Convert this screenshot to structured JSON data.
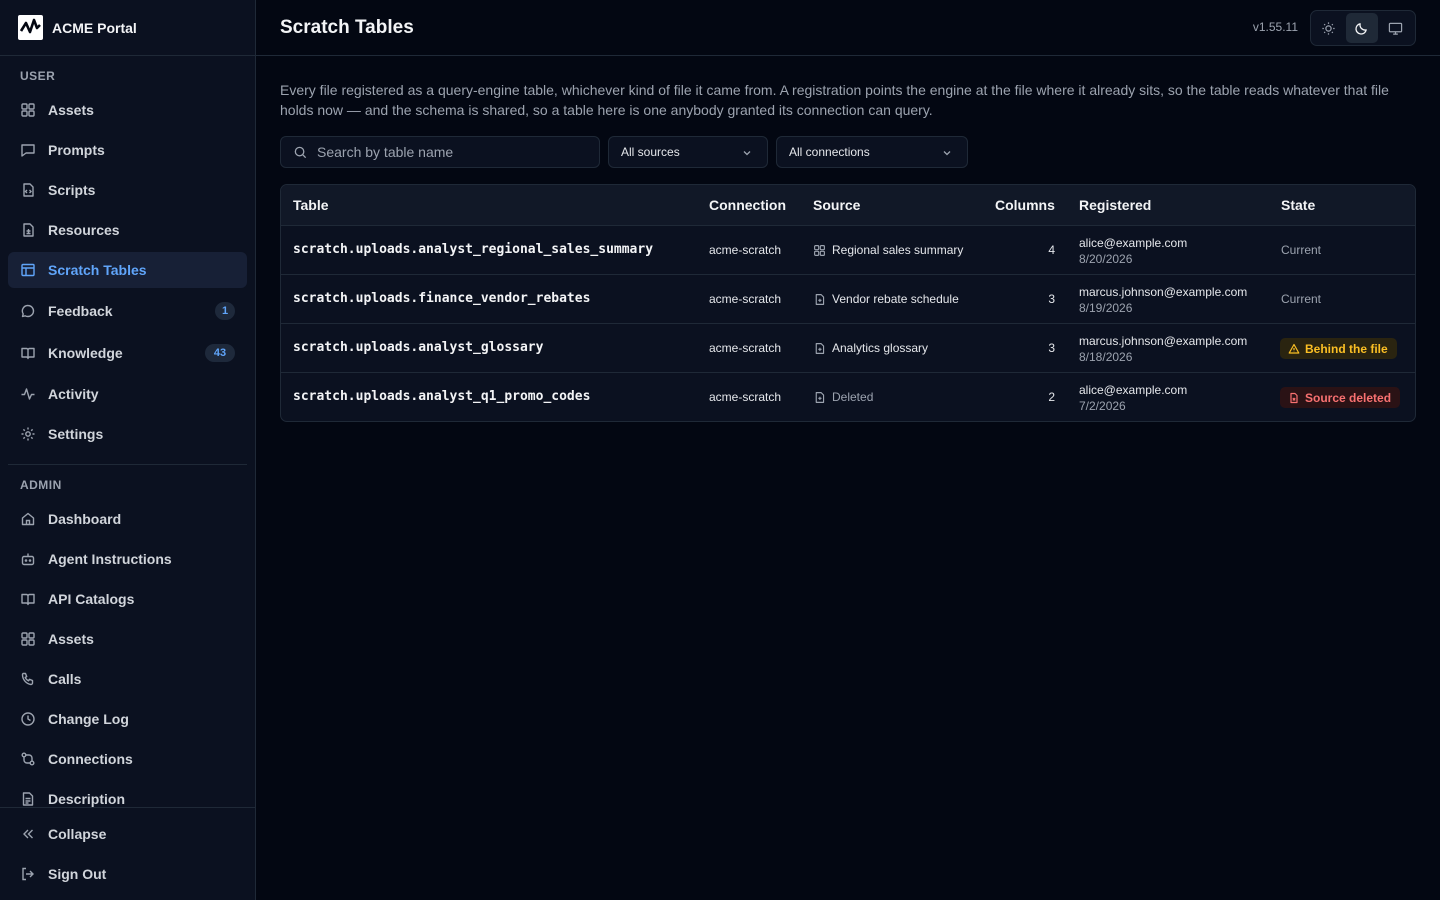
{
  "app": {
    "name": "ACME Portal",
    "version": "v1.55.11"
  },
  "page": {
    "title": "Scratch Tables",
    "description": "Every file registered as a query-engine table, whichever kind of file it came from. A registration points the engine at the file where it already sits, so the table reads whatever that file holds now — and the schema is shared, so a table here is one anybody granted its connection can query."
  },
  "sidebar": {
    "user_label": "USER",
    "admin_label": "ADMIN",
    "user_items": [
      {
        "label": "Assets",
        "icon": "grid-icon"
      },
      {
        "label": "Prompts",
        "icon": "chat-icon"
      },
      {
        "label": "Scripts",
        "icon": "code-icon"
      },
      {
        "label": "Resources",
        "icon": "file-icon"
      },
      {
        "label": "Scratch Tables",
        "icon": "table-icon",
        "active": true
      },
      {
        "label": "Feedback",
        "icon": "message-icon",
        "count": "1"
      },
      {
        "label": "Knowledge",
        "icon": "book-icon",
        "count": "43"
      },
      {
        "label": "Activity",
        "icon": "activity-icon"
      },
      {
        "label": "Settings",
        "icon": "gear-icon"
      }
    ],
    "admin_items": [
      {
        "label": "Dashboard",
        "icon": "home-icon"
      },
      {
        "label": "Agent Instructions",
        "icon": "bot-icon"
      },
      {
        "label": "API Catalogs",
        "icon": "book-icon"
      },
      {
        "label": "Assets",
        "icon": "grid-icon"
      },
      {
        "label": "Calls",
        "icon": "phone-icon"
      },
      {
        "label": "Change Log",
        "icon": "clock-icon"
      },
      {
        "label": "Connections",
        "icon": "connection-icon"
      },
      {
        "label": "Description",
        "icon": "document-icon"
      }
    ],
    "footer": {
      "collapse": "Collapse",
      "sign_out": "Sign Out"
    }
  },
  "filters": {
    "search_placeholder": "Search by table name",
    "sources": "All sources",
    "connections": "All connections"
  },
  "table": {
    "headers": [
      "Table",
      "Connection",
      "Source",
      "Columns",
      "Registered",
      "State"
    ],
    "rows": [
      {
        "name": "scratch.uploads.analyst_regional_sales_summary",
        "connection": "acme-scratch",
        "source": "Regional sales summary",
        "source_icon": "grid-icon",
        "columns": "4",
        "registered_by": "alice@example.com",
        "registered_on": "8/20/2026",
        "state": "Current",
        "state_kind": "plain"
      },
      {
        "name": "scratch.uploads.finance_vendor_rebates",
        "connection": "acme-scratch",
        "source": "Vendor rebate schedule",
        "source_icon": "file-icon",
        "columns": "3",
        "registered_by": "marcus.johnson@example.com",
        "registered_on": "8/19/2026",
        "state": "Current",
        "state_kind": "plain"
      },
      {
        "name": "scratch.uploads.analyst_glossary",
        "connection": "acme-scratch",
        "source": "Analytics glossary",
        "source_icon": "file-icon",
        "columns": "3",
        "registered_by": "marcus.johnson@example.com",
        "registered_on": "8/18/2026",
        "state": "Behind the file",
        "state_kind": "warning"
      },
      {
        "name": "scratch.uploads.analyst_q1_promo_codes",
        "connection": "acme-scratch",
        "source": "Deleted",
        "source_icon": "file-icon",
        "columns": "2",
        "registered_by": "alice@example.com",
        "registered_on": "7/2/2026",
        "state": "Source deleted",
        "state_kind": "danger"
      }
    ]
  },
  "colors": {
    "accent": "#60a5fa",
    "warning": "#fbbf24",
    "danger": "#f87171",
    "background": "#030712"
  }
}
